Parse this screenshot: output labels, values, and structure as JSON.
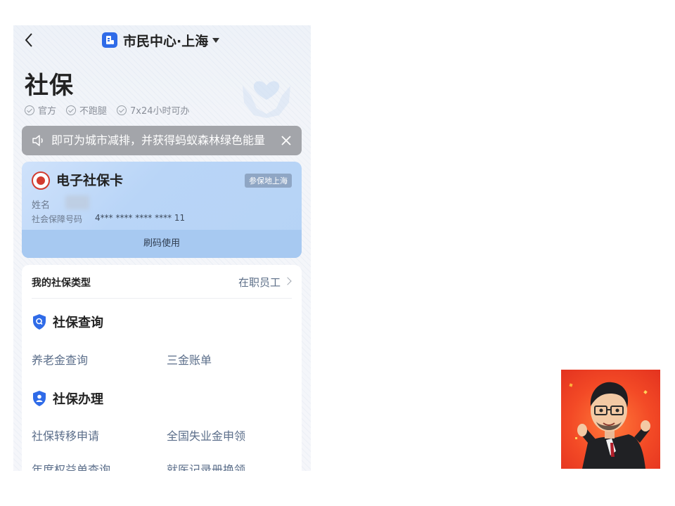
{
  "header": {
    "app_title": "市民中心·上海",
    "page_title": "社保"
  },
  "badges": [
    {
      "label": "官方"
    },
    {
      "label": "不跑腿"
    },
    {
      "label": "7x24小时可办"
    }
  ],
  "notice": {
    "text": "即可为城市减排，并获得蚂蚁森林绿色能量"
  },
  "card": {
    "title": "电子社保卡",
    "tag": "参保地上海",
    "name_label": "姓名",
    "number_label": "社会保障号码",
    "number_value": "4*** **** **** **** 11",
    "action_label": "刷码使用"
  },
  "insurance_type": {
    "label": "我的社保类型",
    "value": "在职员工"
  },
  "sections": [
    {
      "title": "社保查询",
      "items": [
        "养老金查询",
        "三金账单"
      ]
    },
    {
      "title": "社保办理",
      "items": [
        "社保转移申请",
        "全国失业金申领",
        "年度权益单查询",
        "就医记录册换领"
      ]
    }
  ],
  "colors": {
    "brand_blue": "#2f6be8",
    "link_text": "#5b6e8a",
    "notice_bg": "#a3a5aa",
    "card_bg": "#b9d5f7"
  }
}
